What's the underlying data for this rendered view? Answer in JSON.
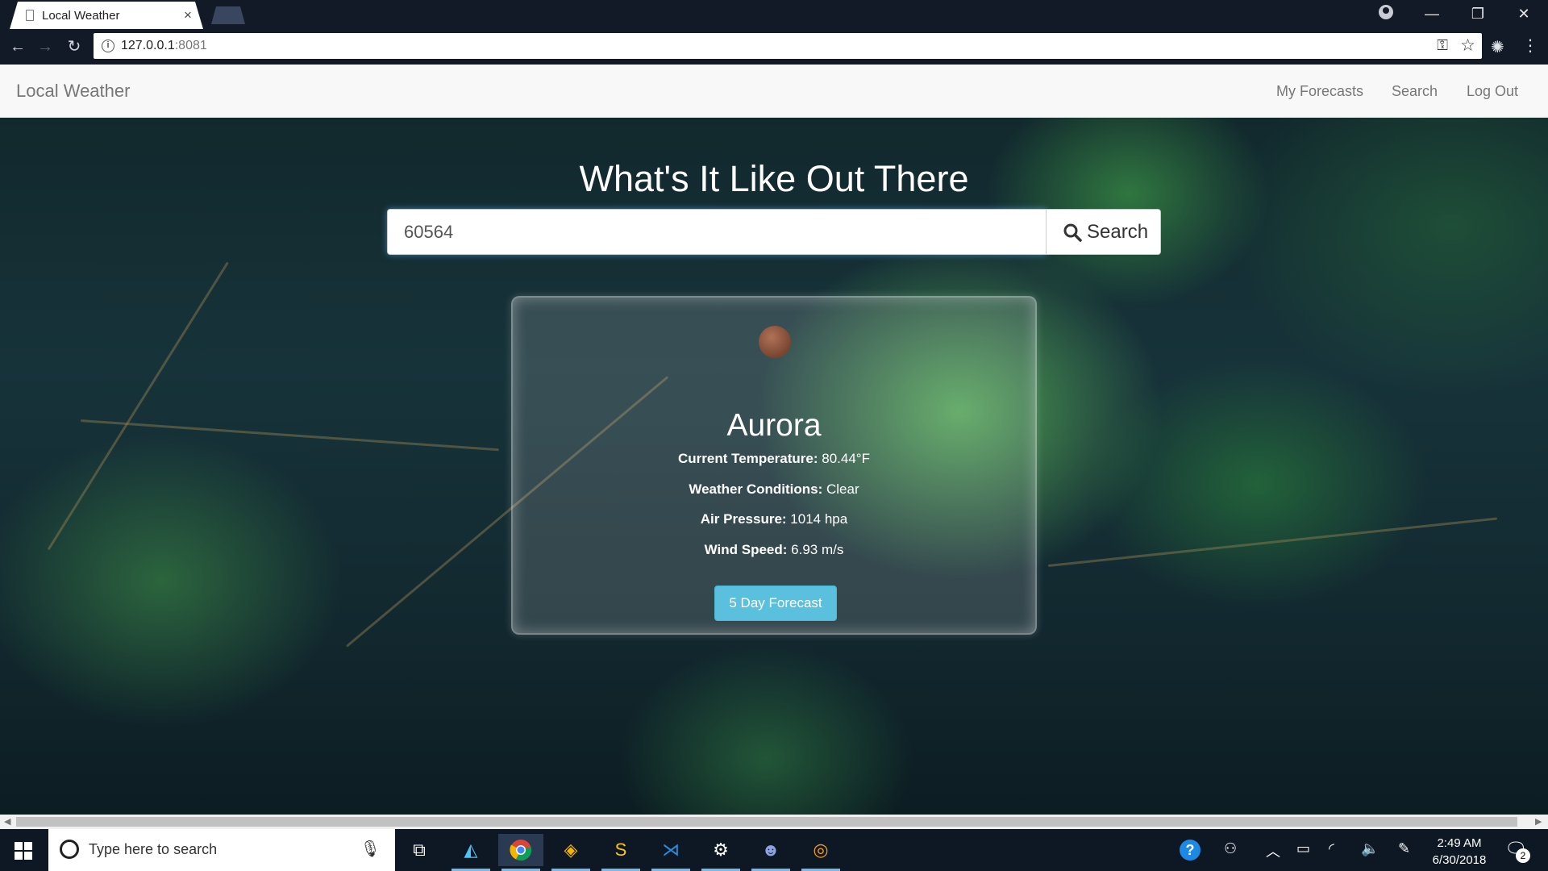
{
  "browser": {
    "tab_title": "Local Weather",
    "tab_close": "×",
    "url_host": "127.0.0.1",
    "url_port": ":8081",
    "window_controls": {
      "minimize": "—",
      "maximize": "❐",
      "close": "✕"
    },
    "nav": {
      "back": "←",
      "forward": "→",
      "reload": "↻"
    }
  },
  "site": {
    "brand": "Local Weather",
    "nav_links": [
      "My Forecasts",
      "Search",
      "Log Out"
    ]
  },
  "hero": {
    "title": "What's It Like Out There",
    "zip_value": "60564",
    "search_label": "Search"
  },
  "weather": {
    "icon": "weather-clear-icon",
    "city": "Aurora",
    "stats": [
      {
        "label": "Current Temperature:",
        "value": " 80.44°F"
      },
      {
        "label": "Weather Conditions:",
        "value": " Clear"
      },
      {
        "label": "Air Pressure:",
        "value": " 1014 hpa"
      },
      {
        "label": "Wind Speed:",
        "value": " 6.93 m/s"
      }
    ],
    "forecast_button": "5 Day Forecast"
  },
  "taskbar": {
    "search_placeholder": "Type here to search",
    "clock_time": "2:49 AM",
    "clock_date": "6/30/2018",
    "notification_count": "2"
  },
  "colors": {
    "accent_button": "#5bc0de",
    "navbar_bg": "#f8f8f8",
    "browser_frame": "#121a28",
    "taskbar_bg": "#0e1824"
  }
}
